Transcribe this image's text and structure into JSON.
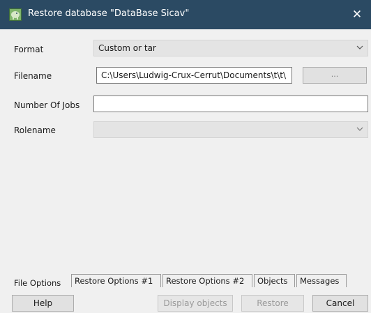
{
  "window": {
    "title": "Restore database \"DataBase Sicav\"",
    "close_glyph": "✕",
    "app_icon": "pgadmin-elephant-icon"
  },
  "form": {
    "format": {
      "label": "Format",
      "value": "Custom or tar"
    },
    "filename": {
      "label": "Filename",
      "value": "C:\\Users\\Ludwig-Crux-Cerrut\\Documents\\t\\t\\",
      "browse_label": "..."
    },
    "jobs": {
      "label": "Number Of Jobs",
      "value": ""
    },
    "rolename": {
      "label": "Rolename",
      "value": ""
    }
  },
  "tabs": [
    {
      "label": "File Options",
      "active": true
    },
    {
      "label": "Restore Options #1",
      "active": false
    },
    {
      "label": "Restore Options #2",
      "active": false
    },
    {
      "label": "Objects",
      "active": false
    },
    {
      "label": "Messages",
      "active": false
    }
  ],
  "buttons": {
    "help": "Help",
    "display_objects": "Display objects",
    "restore": "Restore",
    "cancel": "Cancel"
  },
  "colors": {
    "titlebar": "#2b4a63",
    "background": "#f0f0f0"
  }
}
